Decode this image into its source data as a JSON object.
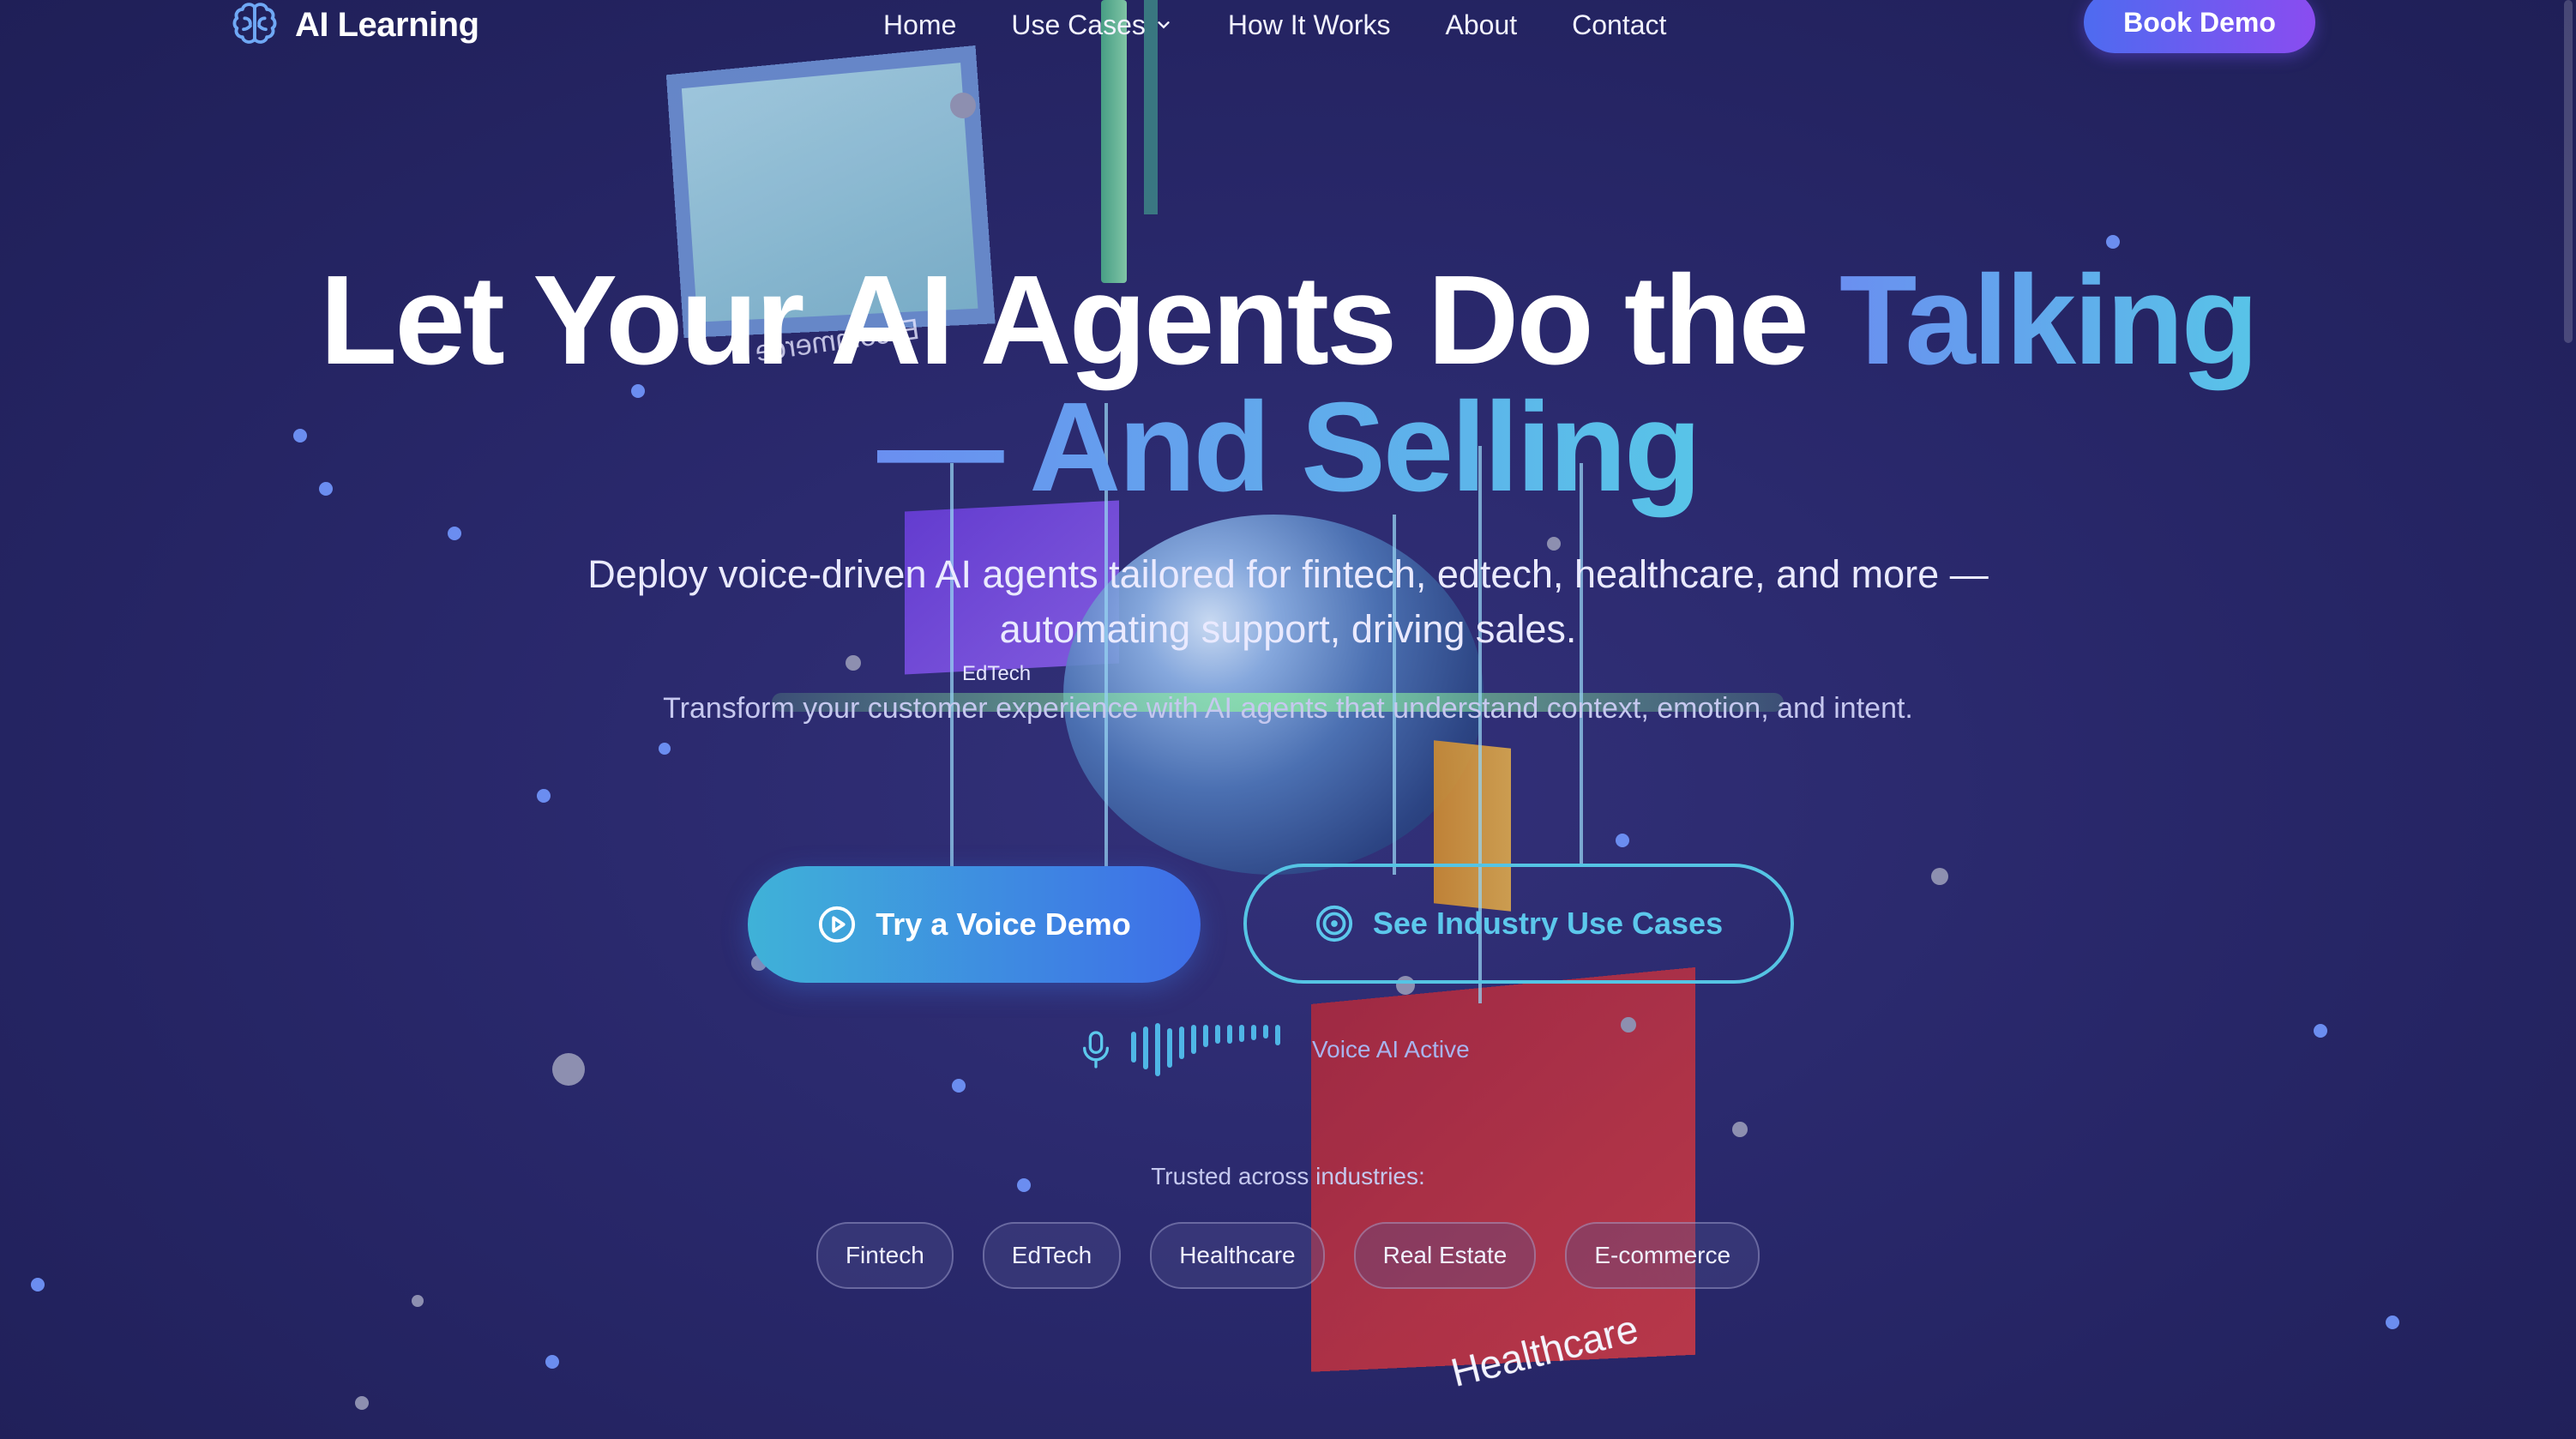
{
  "brand": {
    "name": "AI Learning",
    "logo_icon": "brain-icon"
  },
  "nav": {
    "items": [
      {
        "label": "Home"
      },
      {
        "label": "Use Cases",
        "has_dropdown": true
      },
      {
        "label": "How It Works"
      },
      {
        "label": "About"
      },
      {
        "label": "Contact"
      }
    ],
    "cta": "Book Demo"
  },
  "hero": {
    "title_line1": "Let Your AI Agents Do the ",
    "title_highlight1": "Talking",
    "title_highlight2": "— And Selling",
    "subtitle": "Deploy voice-driven AI agents tailored for fintech, edtech, healthcare, and more — automating support, driving sales.",
    "subtitle2": "Transform your customer experience with AI agents that understand context, emotion, and intent.",
    "primary_button": "Try a Voice Demo",
    "secondary_button": "See Industry Use Cases",
    "voice_status": "Voice AI Active"
  },
  "scene_labels": {
    "edtech": "EdTech",
    "ecommerce": "E-commerce",
    "healthcare": "Healthcare"
  },
  "trusted": {
    "label": "Trusted across industries:",
    "industries": [
      "Fintech",
      "EdTech",
      "Healthcare",
      "Real Estate",
      "E-commerce"
    ]
  },
  "colors": {
    "accent_gradient_start": "#4e6bf0",
    "accent_gradient_end": "#8a4cf0",
    "highlight_blue": "#6a8ff0",
    "highlight_cyan": "#58c4e8",
    "background": "#29286b"
  }
}
